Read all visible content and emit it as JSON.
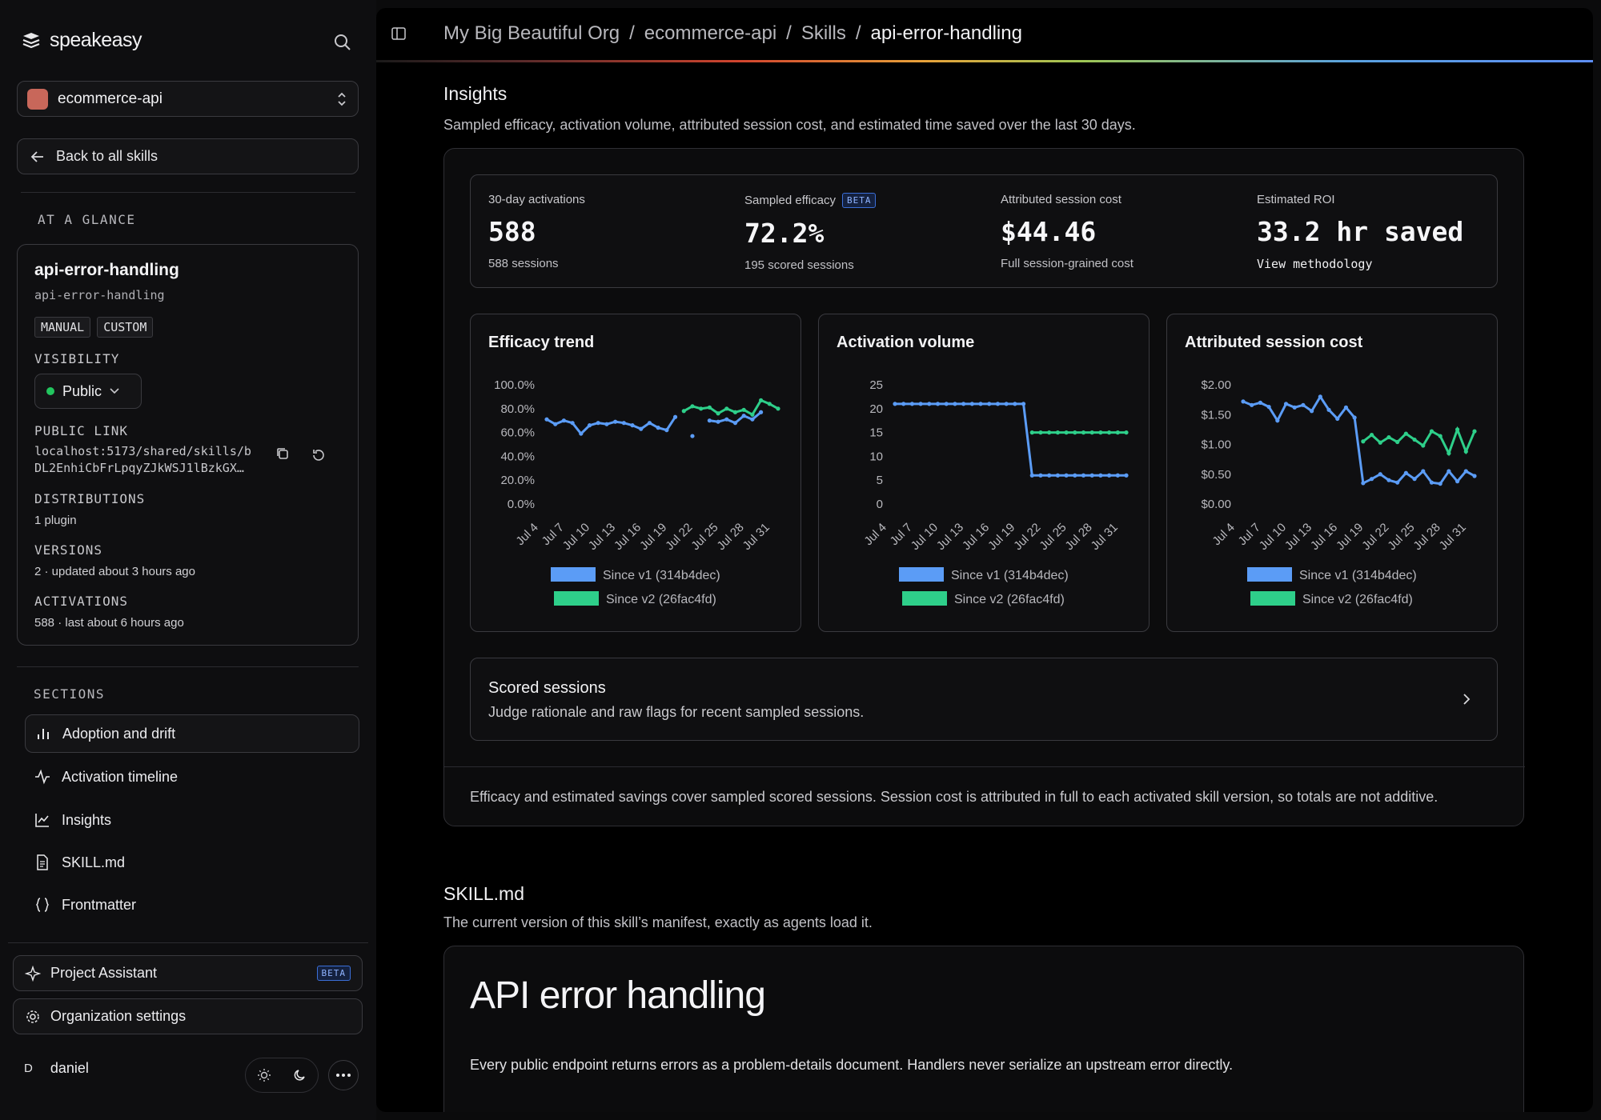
{
  "sidebar": {
    "brand": "speakeasy",
    "project": "ecommerce-api",
    "back_label": "Back to all skills",
    "glance_label": "AT A GLANCE",
    "skill": {
      "name": "api-error-handling",
      "slug": "api-error-handling",
      "tags": [
        "MANUAL",
        "CUSTOM"
      ],
      "visibility_label": "VISIBILITY",
      "visibility_value": "Public",
      "public_link_label": "PUBLIC LINK",
      "public_link_line1": "localhost:5173/shared/skills/b",
      "public_link_line2": "DL2EnhiCbFrLpqyZJkWSJ1lBzkGX…",
      "distributions_label": "DISTRIBUTIONS",
      "distributions_value": "1 plugin",
      "versions_label": "VERSIONS",
      "versions_value": "2 · updated about 3 hours ago",
      "activations_label": "ACTIVATIONS",
      "activations_value": "588 · last about 6 hours ago"
    },
    "sections_label": "SECTIONS",
    "sections": [
      {
        "label": "Adoption and drift",
        "icon": "bar-chart-icon"
      },
      {
        "label": "Activation timeline",
        "icon": "activity-icon"
      },
      {
        "label": "Insights",
        "icon": "line-chart-icon"
      },
      {
        "label": "SKILL.md",
        "icon": "file-icon"
      },
      {
        "label": "Frontmatter",
        "icon": "braces-icon"
      }
    ],
    "assistant_label": "Project Assistant",
    "assistant_badge": "BETA",
    "org_settings_label": "Organization settings",
    "user_initial": "D",
    "user_name": "daniel"
  },
  "breadcrumb": [
    "My Big Beautiful Org",
    "ecommerce-api",
    "Skills",
    "api-error-handling"
  ],
  "insights": {
    "title": "Insights",
    "subtitle": "Sampled efficacy, activation volume, attributed session cost, and estimated time saved over the last 30 days.",
    "kpis": [
      {
        "label": "30-day activations",
        "value": "588",
        "sub": "588 sessions"
      },
      {
        "label": "Sampled efficacy",
        "badge": "BETA",
        "value": "72.2%",
        "sub": "195 scored sessions"
      },
      {
        "label": "Attributed session cost",
        "value": "$44.46",
        "sub": "Full session-grained cost"
      },
      {
        "label": "Estimated ROI",
        "value": "33.2 hr saved",
        "sub": "View methodology"
      }
    ],
    "scored_title": "Scored sessions",
    "scored_sub": "Judge rationale and raw flags for recent sampled sessions.",
    "footnote": "Efficacy and estimated savings cover sampled scored sessions. Session cost is attributed in full to each activated skill version, so totals are not additive."
  },
  "skillmd": {
    "title": "SKILL.md",
    "subtitle": "The current version of this skill’s manifest, exactly as agents load it.",
    "heading": "API error handling",
    "body": "Every public endpoint returns errors as a problem-details document. Handlers never serialize an upstream error directly."
  },
  "colors": {
    "v1": "#5b9cf6",
    "v2": "#2ecf8a"
  },
  "chart_data": [
    {
      "type": "line",
      "title": "Efficacy trend",
      "x": [
        "Jul 4",
        "Jul 5",
        "Jul 6",
        "Jul 7",
        "Jul 8",
        "Jul 9",
        "Jul 10",
        "Jul 11",
        "Jul 12",
        "Jul 13",
        "Jul 14",
        "Jul 15",
        "Jul 16",
        "Jul 17",
        "Jul 18",
        "Jul 19",
        "Jul 20",
        "Jul 21",
        "Jul 22",
        "Jul 23",
        "Jul 24",
        "Jul 25",
        "Jul 26",
        "Jul 27",
        "Jul 28",
        "Jul 29",
        "Jul 30",
        "Jul 31"
      ],
      "x_ticks": [
        "Jul 4",
        "Jul 7",
        "Jul 10",
        "Jul 13",
        "Jul 16",
        "Jul 19",
        "Jul 22",
        "Jul 25",
        "Jul 28",
        "Jul 31"
      ],
      "y_ticks": [
        "0.0%",
        "20.0%",
        "40.0%",
        "60.0%",
        "80.0%",
        "100.0%"
      ],
      "ylim": [
        0,
        100
      ],
      "series": [
        {
          "name": "Since v1 (314b4dec)",
          "values": [
            71,
            67,
            70,
            68,
            59,
            66,
            68,
            67,
            69,
            68,
            66,
            63,
            68,
            64,
            62,
            73,
            null,
            57,
            null,
            70,
            69,
            71,
            68,
            74,
            71,
            77,
            null,
            null
          ]
        },
        {
          "name": "Since v2 (26fac4fd)",
          "values": [
            null,
            null,
            null,
            null,
            null,
            null,
            null,
            null,
            null,
            null,
            null,
            null,
            null,
            null,
            null,
            null,
            78,
            82,
            80,
            81,
            76,
            80,
            77,
            79,
            75,
            87,
            84,
            80
          ]
        }
      ]
    },
    {
      "type": "line",
      "title": "Activation volume",
      "x_ticks": [
        "Jul 4",
        "Jul 7",
        "Jul 10",
        "Jul 13",
        "Jul 16",
        "Jul 19",
        "Jul 22",
        "Jul 25",
        "Jul 28",
        "Jul 31"
      ],
      "y_ticks": [
        "0",
        "5",
        "10",
        "15",
        "20",
        "25"
      ],
      "ylim": [
        0,
        25
      ],
      "series": [
        {
          "name": "Since v1 (314b4dec)",
          "values": [
            21,
            21,
            21,
            21,
            21,
            21,
            21,
            21,
            21,
            21,
            21,
            21,
            21,
            21,
            21,
            21,
            6,
            6,
            6,
            6,
            6,
            6,
            6,
            6,
            6,
            6,
            6,
            6
          ]
        },
        {
          "name": "Since v2 (26fac4fd)",
          "values": [
            null,
            null,
            null,
            null,
            null,
            null,
            null,
            null,
            null,
            null,
            null,
            null,
            null,
            null,
            null,
            null,
            15,
            15,
            15,
            15,
            15,
            15,
            15,
            15,
            15,
            15,
            15,
            15
          ]
        }
      ]
    },
    {
      "type": "line",
      "title": "Attributed session cost",
      "x_ticks": [
        "Jul 4",
        "Jul 7",
        "Jul 10",
        "Jul 13",
        "Jul 16",
        "Jul 19",
        "Jul 22",
        "Jul 25",
        "Jul 28",
        "Jul 31"
      ],
      "y_ticks": [
        "$0.00",
        "$0.50",
        "$1.00",
        "$1.50",
        "$2.00"
      ],
      "ylim": [
        0,
        2
      ],
      "series": [
        {
          "name": "Since v1 (314b4dec)",
          "values": [
            1.72,
            1.66,
            1.7,
            1.63,
            1.4,
            1.68,
            1.62,
            1.66,
            1.56,
            1.8,
            1.58,
            1.43,
            1.62,
            1.45,
            0.35,
            0.42,
            0.5,
            0.4,
            0.36,
            0.52,
            0.42,
            0.55,
            0.36,
            0.34,
            0.55,
            0.38,
            0.55,
            0.47
          ]
        },
        {
          "name": "Since v2 (26fac4fd)",
          "values": [
            null,
            null,
            null,
            null,
            null,
            null,
            null,
            null,
            null,
            null,
            null,
            null,
            null,
            null,
            1.05,
            1.16,
            1.03,
            1.12,
            1.04,
            1.18,
            1.08,
            0.98,
            1.22,
            1.14,
            0.85,
            1.25,
            0.88,
            1.22
          ]
        }
      ]
    }
  ]
}
